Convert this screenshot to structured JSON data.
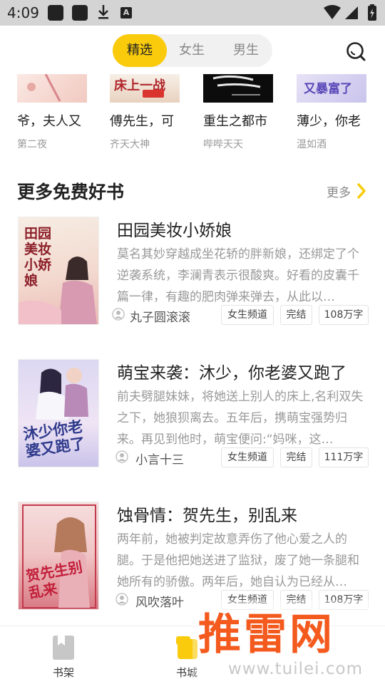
{
  "status_bar": {
    "time": "4:09",
    "accent": "#222222"
  },
  "header": {
    "tabs": [
      {
        "label": "精选",
        "active": true
      },
      {
        "label": "女生",
        "active": false
      },
      {
        "label": "男生",
        "active": false
      }
    ],
    "search_icon": "search-icon",
    "accent_color": "#f9cb0c"
  },
  "carousel": [
    {
      "title": "爷，夫人又",
      "author": "第二夜",
      "cover_text": ""
    },
    {
      "title": "傅先生，可",
      "author": "齐天大神",
      "cover_text": "床上一战"
    },
    {
      "title": "重生之都市",
      "author": "哔哔天天",
      "cover_text": ""
    },
    {
      "title": "薄少，你老",
      "author": "温如酒",
      "cover_text": "又暴富了"
    }
  ],
  "section": {
    "title": "更多免费好书",
    "more_label": "更多"
  },
  "books": [
    {
      "title": "田园美妆小娇娘",
      "description": "莫名其妙穿越成坐花轿的胖新娘，还绑定了个逆袭系统，李澜青表示很酸爽。好看的皮囊千篇一律，有趣的肥肉弹来弹去，从此以…",
      "author": "丸子圆滚滚",
      "tags": [
        "女生频道",
        "完结",
        "108万字"
      ],
      "cover_text": "田园美妆小娇娘"
    },
    {
      "title": "萌宝来袭：沐少，你老婆又跑了",
      "description": "前夫劈腿妹妹，将她送上别人的床上,名利双失之下，她狼狈离去。五年后，携萌宝强势归来。再见到他时，萌宝便问:“妈咪，这…",
      "author": "小言十三",
      "tags": [
        "女生频道",
        "完结",
        "111万字"
      ],
      "cover_text": "沐少你老婆又跑了"
    },
    {
      "title": "蚀骨情：贺先生，别乱来",
      "description": "两年前，她被判定故意弄伤了他心爱之人的腿。于是他把她送进了监狱，废了她一条腿和她所有的骄傲。两年后，她自认为已经从…",
      "author": "风吹落叶",
      "tags": [
        "女生频道",
        "完结",
        "108万字"
      ],
      "cover_text": "贺先生别乱来"
    }
  ],
  "bottom_nav": [
    {
      "label": "书架",
      "icon": "bookshelf-icon"
    },
    {
      "label": "书城",
      "icon": "bookstore-icon"
    }
  ],
  "watermark": {
    "main": "推雷网",
    "sub": "www.tuilei.com"
  }
}
